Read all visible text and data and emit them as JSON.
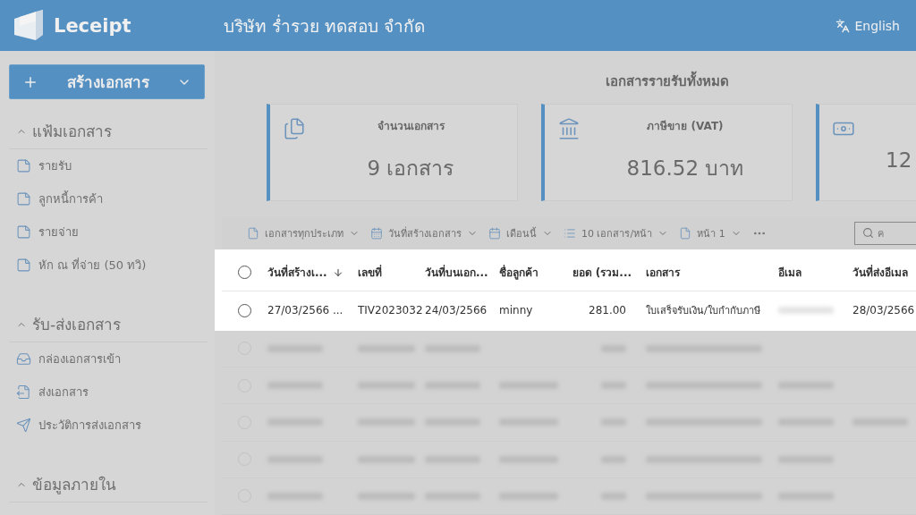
{
  "header": {
    "logo": "Leceipt",
    "company": "บริษัท ร่ำรวย ทดสอบ จำกัด",
    "language": "English"
  },
  "sidebar": {
    "create_button": "สร้างเอกสาร",
    "sections": [
      {
        "title": "แฟ้มเอกสาร",
        "expanded": true,
        "items": [
          "รายรับ",
          "ลูกหนี้การค้า",
          "รายจ่าย",
          "หัก ณ ที่จ่าย (50 ทวิ)"
        ]
      },
      {
        "title": "รับ-ส่งเอกสาร",
        "expanded": true,
        "items": [
          "กล่องเอกสารเข้า",
          "ส่งเอกสาร",
          "ประวัติการส่งเอกสาร"
        ]
      },
      {
        "title": "ข้อมูลภายใน",
        "expanded": true
      }
    ]
  },
  "summary": {
    "title": "เอกสารรายรับทั้งหมด",
    "cards": [
      {
        "label": "จำนวนเอกสาร",
        "value": "9 เอกสาร"
      },
      {
        "label": "ภาษีขาย (VAT)",
        "value": "816.52 บาท"
      },
      {
        "value": "12"
      }
    ]
  },
  "toolbar": {
    "filters": [
      "เอกสารทุกประเภท",
      "วันที่สร้างเอกสาร",
      "เดือนนี้",
      "10 เอกสาร/หน้า",
      "หน้า 1"
    ],
    "search": {
      "placeholder": "ค"
    }
  },
  "table": {
    "select_all_selected": false,
    "columns": [
      {
        "label": "วันที่สร้างเ...",
        "sorted": true
      },
      {
        "label": "เลขที่",
        "sorted": false
      },
      {
        "label": "วันที่บนเอก...",
        "sorted": false
      },
      {
        "label": "ชื่อลูกค้า",
        "sorted": false
      },
      {
        "label": "ยอด (รวม...",
        "sorted": false
      },
      {
        "label": "เอกสาร",
        "sorted": false
      },
      {
        "label": "อีเมล",
        "sorted": false
      },
      {
        "label": "วันที่ส่งอีเมล",
        "sorted": false
      }
    ],
    "rows": [
      {
        "highlighted": true,
        "selected": false,
        "cells": [
          {
            "text": "27/03/2566 ..."
          },
          {
            "text": "TIV2023032"
          },
          {
            "text": "24/03/2566"
          },
          {
            "text": "minny"
          },
          {
            "text": "281.00"
          },
          {
            "text": "ใบเสร็จรับเงิน/ใบกำกับภาษี"
          },
          {
            "redacted": true
          },
          {
            "text": "28/03/2566"
          }
        ]
      },
      {
        "highlighted": false,
        "selected": false,
        "cells": [
          {
            "redacted": true
          },
          {
            "redacted": true
          },
          {
            "redacted": true
          },
          {
            "redacted": false
          },
          {
            "redacted": true
          },
          {
            "redacted": true
          },
          {
            "redacted": false
          },
          {
            "redacted": false
          }
        ]
      },
      {
        "highlighted": false,
        "selected": false,
        "cells": [
          {
            "redacted": true
          },
          {
            "redacted": true
          },
          {
            "redacted": true
          },
          {
            "redacted": true
          },
          {
            "redacted": true
          },
          {
            "redacted": true
          },
          {
            "redacted": true
          },
          {
            "redacted": false
          }
        ]
      },
      {
        "highlighted": false,
        "selected": false,
        "cells": [
          {
            "redacted": true
          },
          {
            "redacted": true
          },
          {
            "redacted": true
          },
          {
            "redacted": true
          },
          {
            "redacted": true
          },
          {
            "redacted": true
          },
          {
            "redacted": true
          },
          {
            "redacted": true
          }
        ]
      },
      {
        "highlighted": false,
        "selected": false,
        "cells": [
          {
            "redacted": true
          },
          {
            "redacted": true
          },
          {
            "redacted": true
          },
          {
            "redacted": true
          },
          {
            "redacted": true
          },
          {
            "redacted": true
          },
          {
            "redacted": true
          },
          {
            "redacted": false
          }
        ]
      },
      {
        "highlighted": false,
        "selected": false,
        "cells": [
          {
            "redacted": true
          },
          {
            "redacted": true
          },
          {
            "redacted": true
          },
          {
            "redacted": true
          },
          {
            "redacted": true
          },
          {
            "redacted": true
          },
          {
            "redacted": true
          },
          {
            "redacted": false
          }
        ]
      }
    ]
  }
}
